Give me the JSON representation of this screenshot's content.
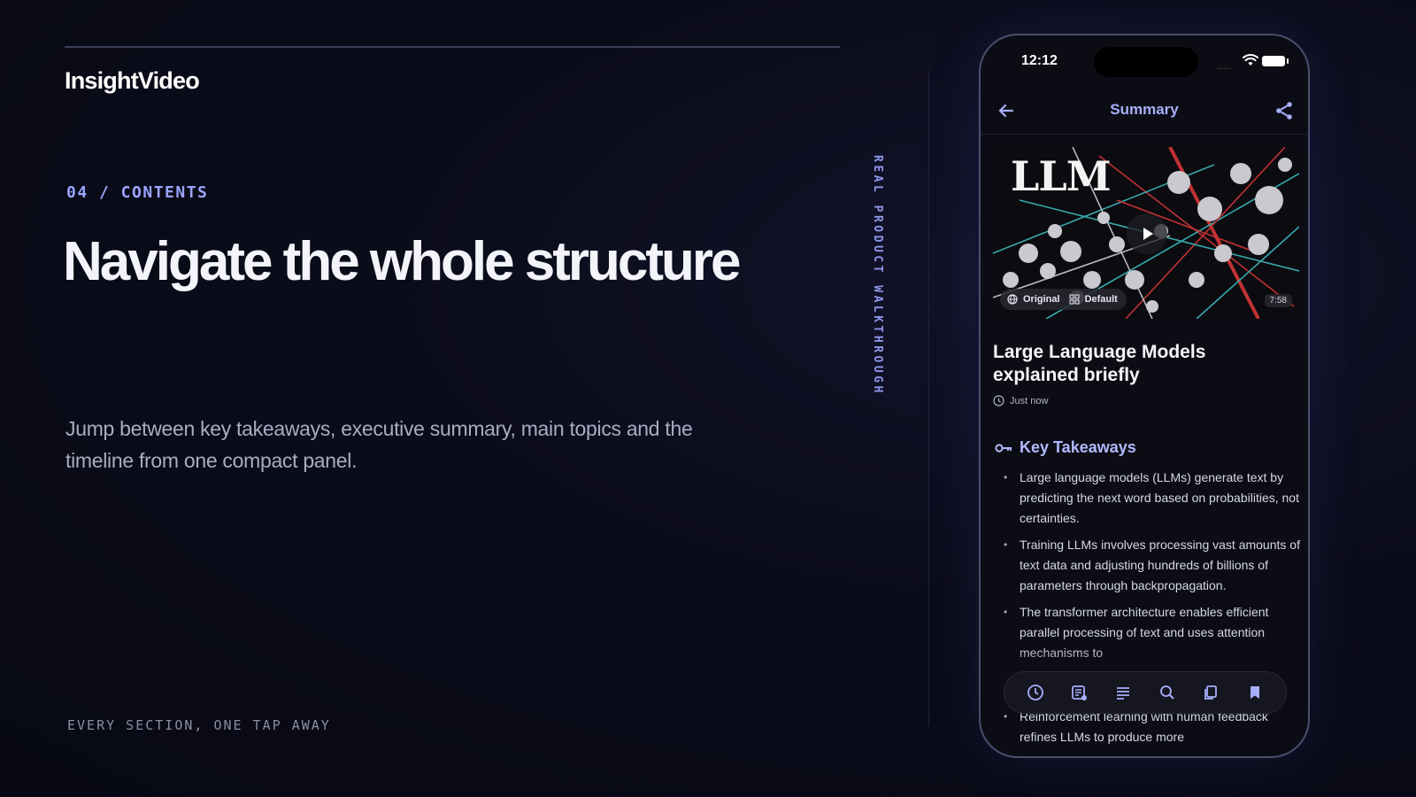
{
  "slide": {
    "brand": "InsightVideo",
    "eyebrow": "04 / CONTENTS",
    "headline": "Navigate the whole structure",
    "description": "Jump between key takeaways, executive summary, main topics and the timeline from one compact panel.",
    "footer_caption": "EVERY SECTION, ONE TAP AWAY",
    "vertical_label": "REAL PRODUCT WALKTHROUGH"
  },
  "phone": {
    "status_time": "12:12",
    "signal": "....",
    "nav": {
      "title": "Summary",
      "back_icon": "arrow-left-icon",
      "share_icon": "share-icon"
    },
    "video": {
      "thumbnail_title": "LLM",
      "badge_original": "Original",
      "badge_default": "Default",
      "duration": "7:58",
      "title": "Large Language Models explained briefly",
      "timestamp": "Just now"
    },
    "key_takeaways": {
      "heading": "Key Takeaways",
      "items": [
        "Large language models (LLMs) generate text by predicting the next word based on probabilities, not certainties.",
        "Training LLMs involves processing vast amounts of text data and adjusting hundreds of billions of parameters through backpropagation.",
        "The transformer architecture enables efficient parallel processing of text and uses attention mechanisms to"
      ],
      "items_below_toolbar": [
        "Reinforcement learning with human feedback refines LLMs to produce more"
      ]
    },
    "toolbar": {
      "icons": [
        "clock-icon",
        "summary-icon",
        "list-icon",
        "search-icon",
        "copy-icon",
        "bookmark-icon"
      ]
    }
  },
  "colors": {
    "accent": "#a7aefc",
    "eyebrow": "#9aa4ff",
    "background": "#0b0c1a"
  }
}
